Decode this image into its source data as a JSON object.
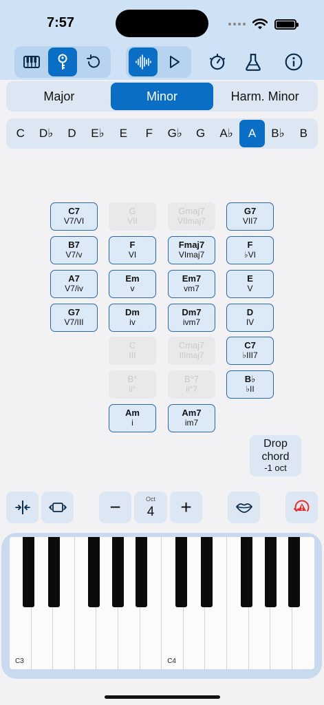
{
  "status": {
    "time": "7:57"
  },
  "toolbar": {
    "icons": [
      "piano-icon",
      "key-icon",
      "undo-icon",
      "waveform-icon",
      "play-icon",
      "metronome-icon",
      "flask-icon",
      "info-icon"
    ]
  },
  "scale": {
    "options": [
      "Major",
      "Minor",
      "Harm. Minor"
    ],
    "selected": "Minor"
  },
  "keys": {
    "options": [
      "C",
      "D♭",
      "D",
      "E♭",
      "E",
      "F",
      "G♭",
      "G",
      "A♭",
      "A",
      "B♭",
      "B"
    ],
    "selected": "A"
  },
  "chords": [
    {
      "name": "C7",
      "degree": "V7/VI",
      "enabled": true
    },
    {
      "name": "G",
      "degree": "VII",
      "enabled": false
    },
    {
      "name": "Gmaj7",
      "degree": "VIImaj7",
      "enabled": false
    },
    {
      "name": "G7",
      "degree": "VII7",
      "enabled": true
    },
    {
      "name": "B7",
      "degree": "V7/v",
      "enabled": true
    },
    {
      "name": "F",
      "degree": "VI",
      "enabled": true
    },
    {
      "name": "Fmaj7",
      "degree": "VImaj7",
      "enabled": true
    },
    {
      "name": "F",
      "degree": "♭VI",
      "enabled": true
    },
    {
      "name": "A7",
      "degree": "V7/iv",
      "enabled": true
    },
    {
      "name": "Em",
      "degree": "v",
      "enabled": true
    },
    {
      "name": "Em7",
      "degree": "vm7",
      "enabled": true
    },
    {
      "name": "E",
      "degree": "V",
      "enabled": true
    },
    {
      "name": "G7",
      "degree": "V7/III",
      "enabled": true
    },
    {
      "name": "Dm",
      "degree": "iv",
      "enabled": true
    },
    {
      "name": "Dm7",
      "degree": "ivm7",
      "enabled": true
    },
    {
      "name": "D",
      "degree": "IV",
      "enabled": true
    },
    {
      "name": "C",
      "degree": "III",
      "enabled": false
    },
    {
      "name": "Cmaj7",
      "degree": "IIImaj7",
      "enabled": false
    },
    {
      "name": "C7",
      "degree": "♭III7",
      "enabled": true
    },
    {
      "name": "B°",
      "degree": "ii°",
      "enabled": false
    },
    {
      "name": "B°7",
      "degree": "ii°7",
      "enabled": false
    },
    {
      "name": "B♭",
      "degree": "♭II",
      "enabled": true
    },
    {
      "name": "Am",
      "degree": "i",
      "enabled": true
    },
    {
      "name": "Am7",
      "degree": "im7",
      "enabled": true
    }
  ],
  "drop": {
    "line1": "Drop",
    "line2": "chord",
    "line3": "-1 oct"
  },
  "controls": {
    "octave_label": "Oct",
    "octave_value": "4",
    "minus": "−",
    "plus": "+",
    "icons": [
      "compress-icon",
      "expand-icon",
      "lips-icon",
      "alert-icon"
    ]
  },
  "piano": {
    "label_c3": "C3",
    "label_c4": "C4"
  }
}
